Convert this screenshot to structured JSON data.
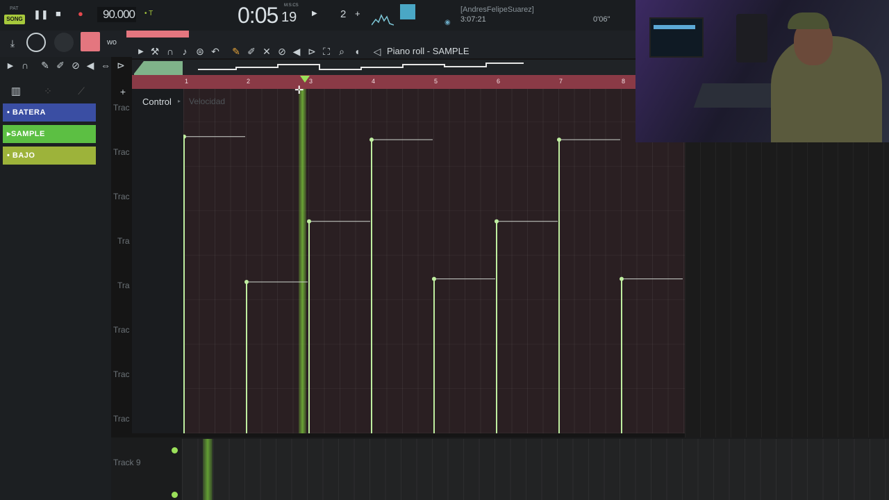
{
  "transport": {
    "pat_label": "PAT",
    "song_label": "SONG",
    "tempo": "90.000",
    "time_main": "0:05",
    "time_small": "19",
    "time_unit": "M:S:CS",
    "pattern_number": "2",
    "user": "[AndresFelipeSuarez]",
    "clock": "3:07:21",
    "cpu_time": "0'06''"
  },
  "piano_roll": {
    "title": "Piano roll - SAMPLE",
    "control_label": "Control",
    "control_value": "Velocidad",
    "ruler": [
      "1",
      "2",
      "3",
      "4",
      "5",
      "6",
      "7",
      "8"
    ]
  },
  "playlist": {
    "tracks": [
      {
        "label": "BATERA",
        "color": "#3a4ea3"
      },
      {
        "label": "SAMPLE",
        "color": "#5cbf43"
      },
      {
        "label": "BAJO",
        "color": "#9db33a"
      }
    ],
    "track_labels": [
      "Trac",
      "Trac",
      "Trac",
      "Tra",
      "Tra",
      "Trac",
      "Trac",
      "Trac"
    ],
    "bottom_track": "Track 9"
  },
  "velocity_notes": [
    {
      "step": 1,
      "velocity": 0.98
    },
    {
      "step": 2,
      "velocity": 0.5
    },
    {
      "step": 3,
      "velocity": 0.7
    },
    {
      "step": 4,
      "velocity": 0.97
    },
    {
      "step": 5,
      "velocity": 0.51
    },
    {
      "step": 6,
      "velocity": 0.7
    },
    {
      "step": 7,
      "velocity": 0.97
    },
    {
      "step": 8,
      "velocity": 0.51
    }
  ],
  "colors": {
    "accent": "#a8e07a",
    "ruler": "#8a3a46",
    "playhead": "#7fd13b"
  }
}
